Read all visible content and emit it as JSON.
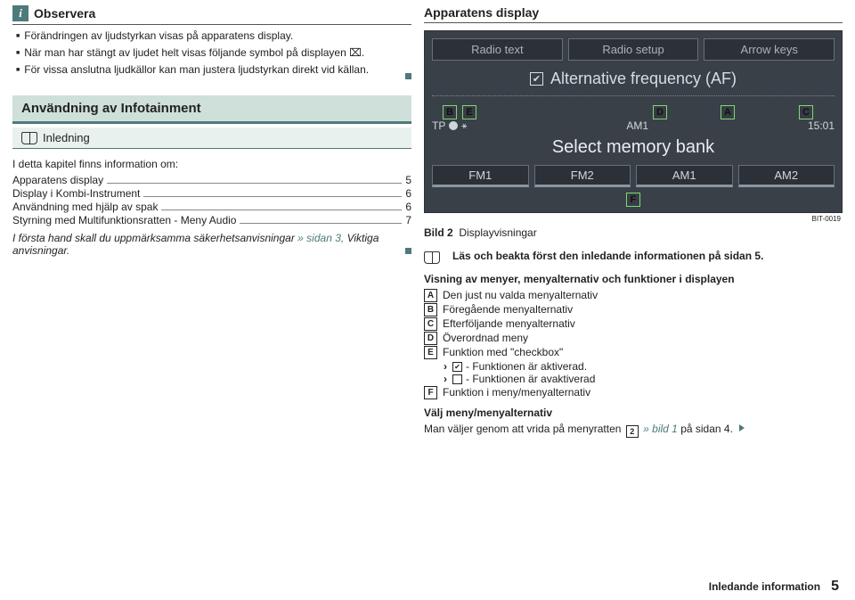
{
  "observera": {
    "title": "Observera",
    "items": [
      "Förändringen av ljudstyrkan visas på apparatens display.",
      "När man har stängt av ljudet helt visas följande symbol på displayen ⌧.",
      "För vissa anslutna ljudkällor kan man justera ljudstyrkan direkt vid källan."
    ]
  },
  "section": {
    "title": "Användning av Infotainment",
    "sub": "Inledning"
  },
  "toc": {
    "intro": "I detta kapitel finns information om:",
    "rows": [
      {
        "label": "Apparatens display",
        "page": "5"
      },
      {
        "label": "Display i Kombi-Instrument",
        "page": "6"
      },
      {
        "label": "Användning med hjälp av spak",
        "page": "6"
      },
      {
        "label": "Styrning med Multifunktionsratten - Meny Audio",
        "page": "7"
      }
    ],
    "note_pre": "I första hand skall du uppmärksamma säkerhetsanvisningar",
    "note_link": "» sidan 3,",
    "note_post": "Viktiga anvisningar."
  },
  "display": {
    "heading": "Apparatens display",
    "tabs": [
      "Radio text",
      "Radio setup",
      "Arrow keys"
    ],
    "af": "Alternative frequency (AF)",
    "callouts": {
      "B": "B",
      "E": "E",
      "D": "D",
      "A": "A",
      "C": "C",
      "F": "F"
    },
    "status": {
      "tp": "TP",
      "band": "AM1",
      "time": "15:01"
    },
    "select": "Select memory bank",
    "bands": [
      "FM1",
      "FM2",
      "AM1",
      "AM2"
    ],
    "bitcode": "BIT-0019",
    "caption_bold": "Bild 2",
    "caption_rest": "Displayvisningar"
  },
  "readfirst": "Läs och beakta först den inledande informationen på sidan 5.",
  "menudesc": {
    "heading": "Visning av menyer, menyalternativ och funktioner i displayen",
    "rows": {
      "A": "Den just nu valda menyalternativ",
      "B": "Föregående menyalternativ",
      "C": "Efterföljande menyalternativ",
      "D": "Överordnad meny",
      "E": "Funktion med \"checkbox\"",
      "E1": "- Funktionen är aktiverad.",
      "E2": "- Funktionen är avaktiverad",
      "F": "Funktion i meny/menyalternativ"
    },
    "select_h": "Välj meny/menyalternativ",
    "select_t1": "Man väljer genom att vrida på menyratten",
    "select_link": "» bild 1",
    "select_t2": "på sidan 4."
  },
  "footer": {
    "text": "Inledande information",
    "page": "5"
  }
}
